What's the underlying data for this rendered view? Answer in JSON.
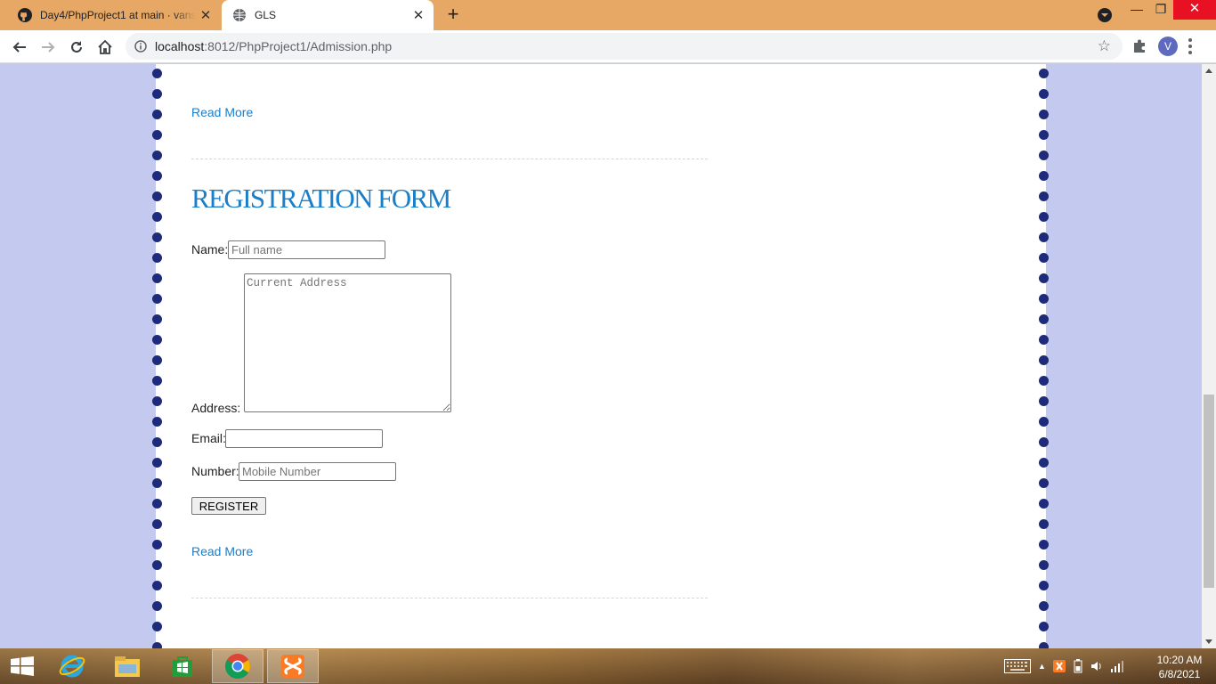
{
  "browser": {
    "tabs": [
      {
        "title": "Day4/PhpProject1 at main · vansl",
        "icon": "github-icon",
        "active": false
      },
      {
        "title": "GLS",
        "icon": "globe-icon",
        "active": true
      }
    ],
    "new_tab_symbol": "+",
    "address": {
      "host": "localhost",
      "rest": ":8012/PhpProject1/Admission.php"
    },
    "profile_initial": "V"
  },
  "page": {
    "read_more_top": "Read More",
    "heading": "REGISTRATION FORM",
    "form": {
      "name_label": "Name:",
      "name_placeholder": "Full name",
      "address_label": "Address:",
      "address_placeholder": "Current Address",
      "email_label": "Email:",
      "email_placeholder": "",
      "number_label": "Number:",
      "number_placeholder": "Mobile Number",
      "submit_label": "REGISTER"
    },
    "read_more_bottom": "Read More"
  },
  "colors": {
    "link": "#1a7ec8",
    "page_background": "#c4c9ef",
    "border_dots": "#1e2a7a",
    "tabbar": "#e7a866"
  },
  "taskbar": {
    "apps": [
      "internet-explorer-icon",
      "file-explorer-icon",
      "store-icon",
      "chrome-icon",
      "xampp-icon"
    ],
    "time": "10:20 AM",
    "date": "6/8/2021"
  }
}
